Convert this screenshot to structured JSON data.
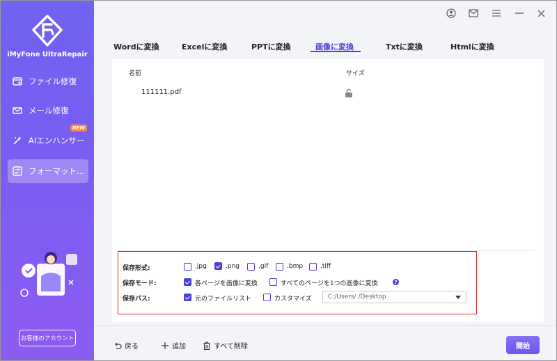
{
  "app": {
    "name": "iMyFone UltraRepair"
  },
  "sidebar": {
    "items": [
      {
        "label": "ファイル修復",
        "icon": "file-repair-icon"
      },
      {
        "label": "メール修復",
        "icon": "mail-repair-icon"
      },
      {
        "label": "AIエンハンサー",
        "icon": "ai-enhancer-icon",
        "badge": "NEW"
      },
      {
        "label": "フォーマット...",
        "icon": "format-convert-icon",
        "active": true
      }
    ],
    "account_button": "お客様のアカウント"
  },
  "tabs": [
    {
      "label": "Wordに変換"
    },
    {
      "label": "Excelに変換"
    },
    {
      "label": "PPTに変換"
    },
    {
      "label": "画像に変換",
      "active": true
    },
    {
      "label": "Txtに変換"
    },
    {
      "label": "Htmlに変換"
    }
  ],
  "file_list": {
    "headers": {
      "name": "名前",
      "size": "サイズ"
    },
    "files": [
      {
        "name": "111111.pdf",
        "status_icon": "unlocked-icon"
      }
    ]
  },
  "options": {
    "format": {
      "label": "保存形式:",
      "choices": [
        {
          "label": ".jpg",
          "checked": false
        },
        {
          "label": ".png",
          "checked": true
        },
        {
          "label": ".gif",
          "checked": false
        },
        {
          "label": ".bmp",
          "checked": false
        },
        {
          "label": ".tiff",
          "checked": false
        }
      ]
    },
    "mode": {
      "label": "保存モード:",
      "choices": [
        {
          "label": "各ページを画像に変換",
          "checked": true
        },
        {
          "label": "すべてのページを1つの画像に変換",
          "checked": false
        }
      ]
    },
    "path": {
      "label": "保存パス:",
      "choices": [
        {
          "label": "元のファイルリスト",
          "checked": true
        },
        {
          "label": "カスタマイズ",
          "checked": false
        }
      ],
      "value": "C:/Users/            /Desktop"
    }
  },
  "bottom": {
    "back": "戻る",
    "add": "追加",
    "delete_all": "すべて削除",
    "start": "開始"
  },
  "colors": {
    "accent": "#4b3fd8",
    "sidebar_top": "#6f63f0",
    "highlight_border": "#e02020"
  }
}
